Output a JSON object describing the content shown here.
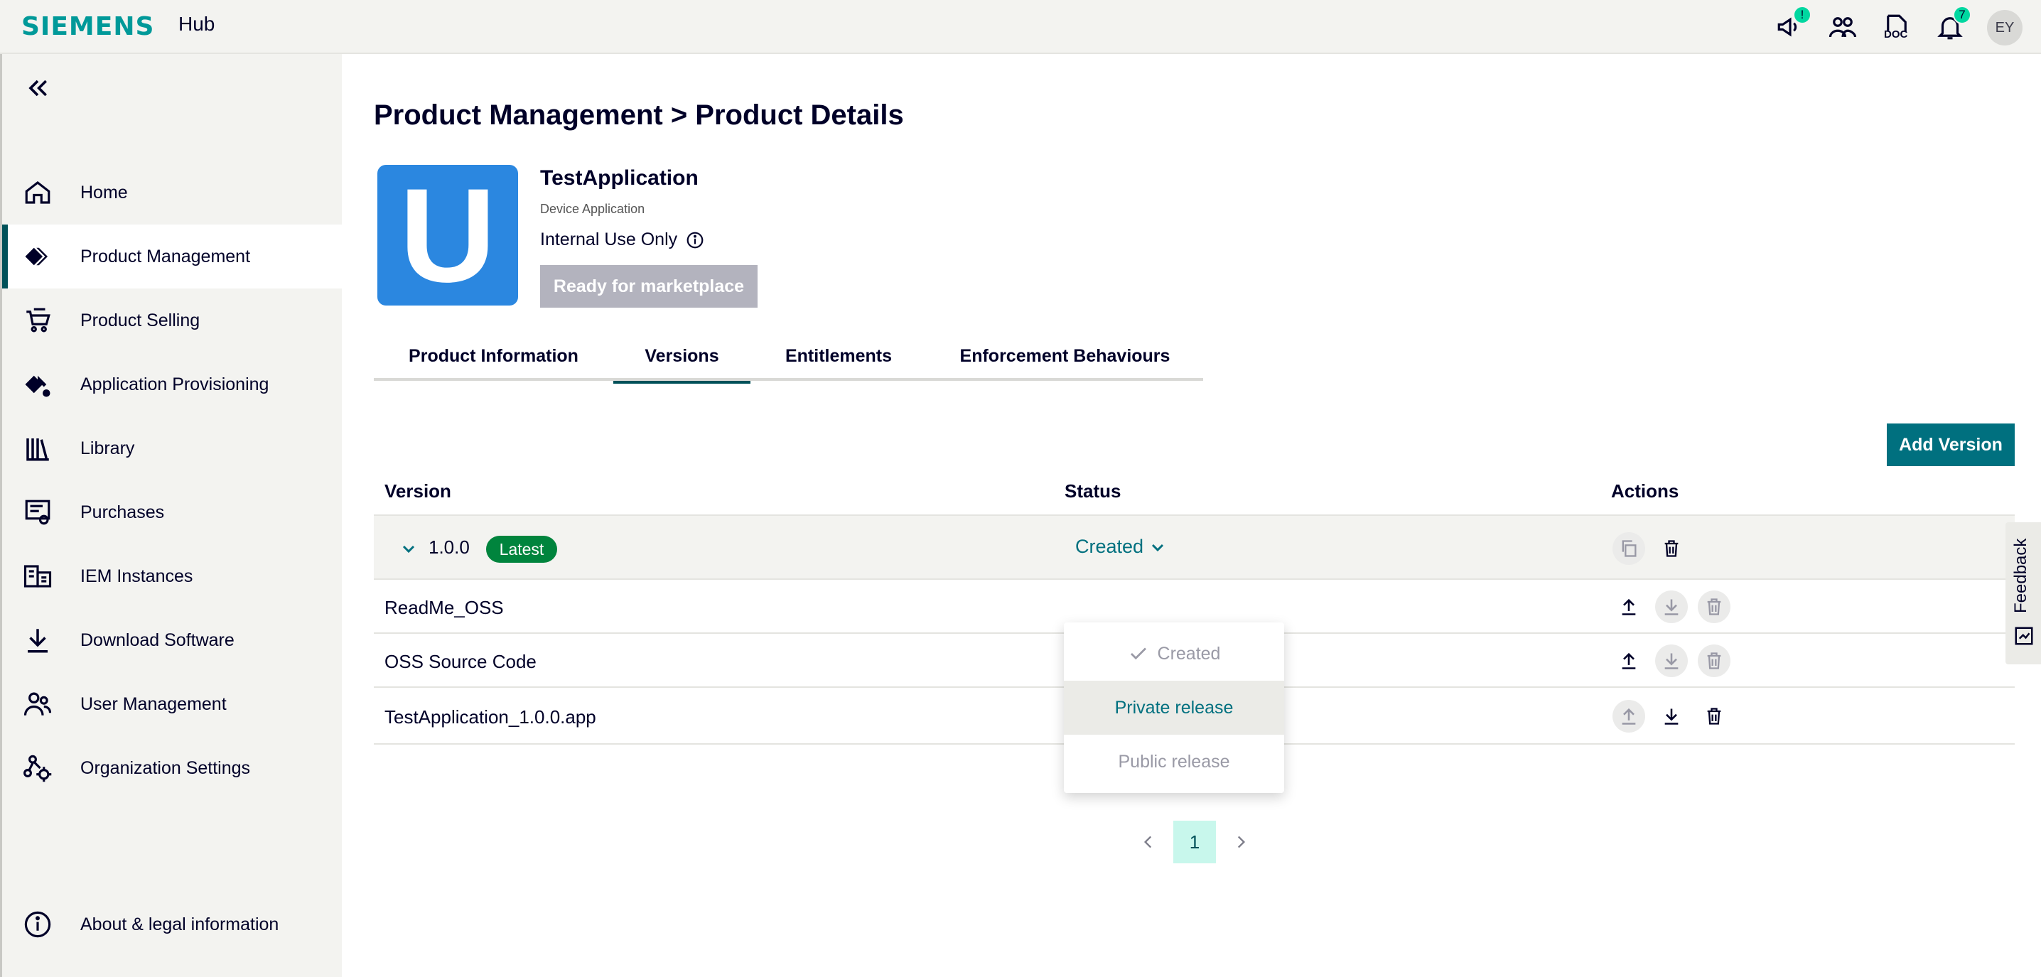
{
  "topbar": {
    "brand": "SIEMENS",
    "app": "Hub",
    "announcement_badge": "!",
    "doc_label": "DOC",
    "notification_count": "7",
    "avatar_initials": "EY"
  },
  "sidebar": {
    "items": [
      {
        "label": "Home",
        "icon": "home-icon"
      },
      {
        "label": "Product Management",
        "icon": "product-management-icon",
        "active": true
      },
      {
        "label": "Product Selling",
        "icon": "cart-icon"
      },
      {
        "label": "Application Provisioning",
        "icon": "provisioning-icon"
      },
      {
        "label": "Library",
        "icon": "library-icon"
      },
      {
        "label": "Purchases",
        "icon": "purchases-icon"
      },
      {
        "label": "IEM Instances",
        "icon": "iem-icon"
      },
      {
        "label": "Download Software",
        "icon": "download-icon"
      },
      {
        "label": "User Management",
        "icon": "users-icon"
      },
      {
        "label": "Organization Settings",
        "icon": "org-settings-icon"
      }
    ],
    "footer_label": "About & legal information"
  },
  "page": {
    "title": "Product Management > Product Details"
  },
  "product": {
    "logo_letter": "U",
    "name": "TestApplication",
    "type": "Device Application",
    "visibility": "Internal Use Only",
    "ready_button": "Ready for marketplace"
  },
  "tabs": [
    {
      "label": "Product Information"
    },
    {
      "label": "Versions",
      "active": true
    },
    {
      "label": "Entitlements"
    },
    {
      "label": "Enforcement Behaviours"
    }
  ],
  "versions": {
    "add_button": "Add Version",
    "columns": [
      "Version",
      "Status",
      "Actions"
    ],
    "version_row": {
      "version": "1.0.0",
      "tag": "Latest",
      "status": "Created"
    },
    "files": [
      {
        "name": "ReadMe_OSS"
      },
      {
        "name": "OSS Source Code"
      },
      {
        "name": "TestApplication_1.0.0.app"
      }
    ],
    "status_options": [
      {
        "label": "Created",
        "selected": true,
        "disabled": true
      },
      {
        "label": "Private release",
        "hovered": true
      },
      {
        "label": "Public release",
        "disabled": true
      }
    ]
  },
  "pagination": {
    "current": "1"
  },
  "feedback": {
    "label": "Feedback"
  },
  "colors": {
    "brand": "#009999",
    "primary": "#00707f",
    "latest_badge": "#00843d",
    "logo_bg": "#2b87e0"
  }
}
